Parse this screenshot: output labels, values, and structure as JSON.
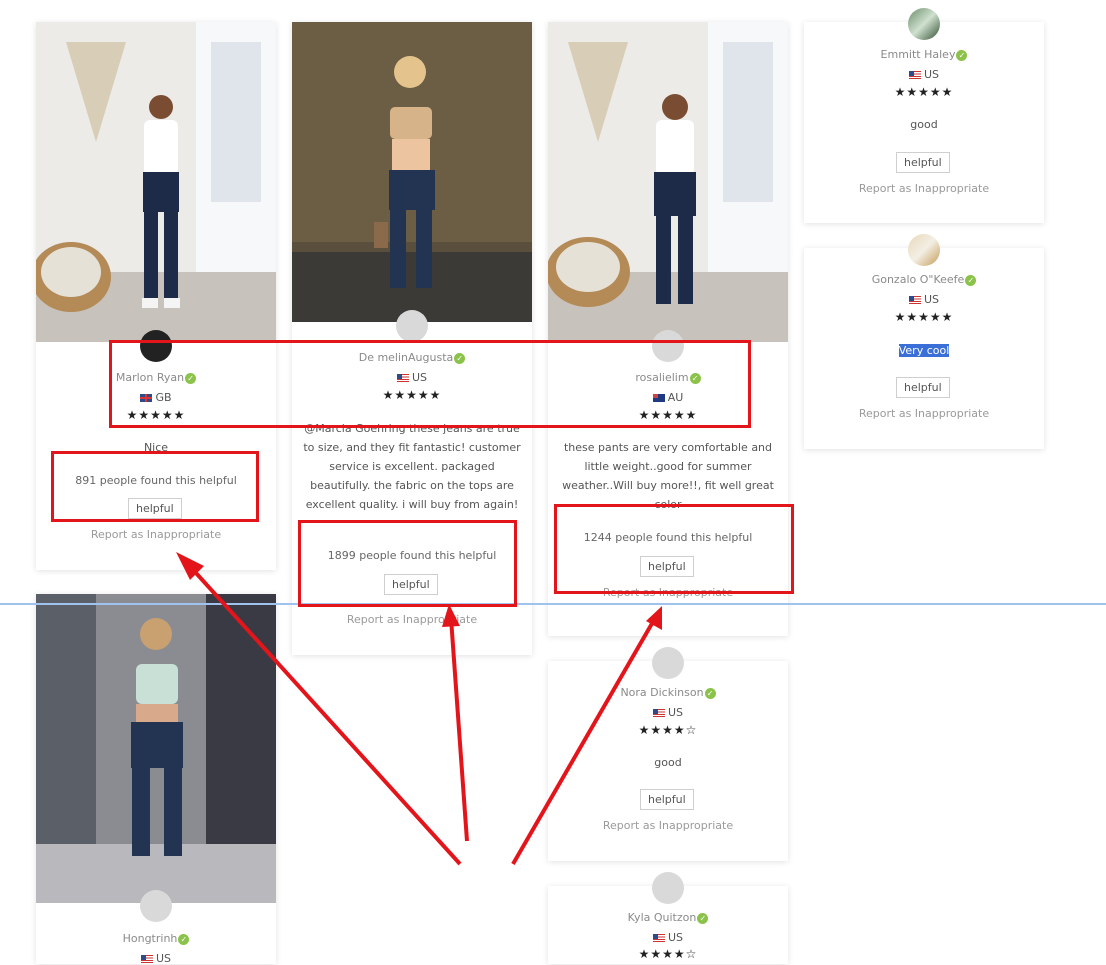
{
  "reviews": [
    {
      "name": "Marlon Ryan",
      "country": "GB",
      "stars": "★★★★★",
      "text": "Nice",
      "helpful_count": "891 people found this helpful",
      "helpful_label": "helpful",
      "report_label": "Report as Inappropriate"
    },
    {
      "name": "De melinAugusta",
      "country": "US",
      "stars": "★★★★★",
      "text": "@Marcia Goehring these jeans are true to size, and they fit fantastic! customer service is excellent. packaged beautifully. the fabric on the tops are excellent quality. i will buy from again!",
      "helpful_count": "1899 people found this helpful",
      "helpful_label": "helpful",
      "report_label": "Report as Inappropriate"
    },
    {
      "name": "rosalielim",
      "country": "AU",
      "stars": "★★★★★",
      "text": "these pants are very comfortable and little weight..good for summer weather..Will buy more!!, fit well great color",
      "helpful_count": "1244 people found this helpful",
      "helpful_label": "helpful",
      "report_label": "Report as Inappropriate"
    },
    {
      "name": "Emmitt Haley",
      "country": "US",
      "stars": "★★★★★",
      "text": "good",
      "helpful_label": "helpful",
      "report_label": "Report as Inappropriate"
    },
    {
      "name": "Gonzalo O\"Keefe",
      "country": "US",
      "stars": "★★★★★",
      "text": "Very cool",
      "helpful_label": "helpful",
      "report_label": "Report as Inappropriate"
    },
    {
      "name": "Nora Dickinson",
      "country": "US",
      "stars": "★★★★☆",
      "text": "good",
      "helpful_label": "helpful",
      "report_label": "Report as Inappropriate"
    },
    {
      "name": "Hongtrinh",
      "country": "US"
    },
    {
      "name": "Kyla Quitzon",
      "country": "US",
      "stars": "★★★★☆"
    }
  ],
  "icons": {
    "verified": "verified-check-icon",
    "avatar": "user-avatar-icon"
  },
  "colors": {
    "annotation": "#e3151b",
    "verified": "#8bc34a",
    "selection": "#3a6fd8"
  }
}
